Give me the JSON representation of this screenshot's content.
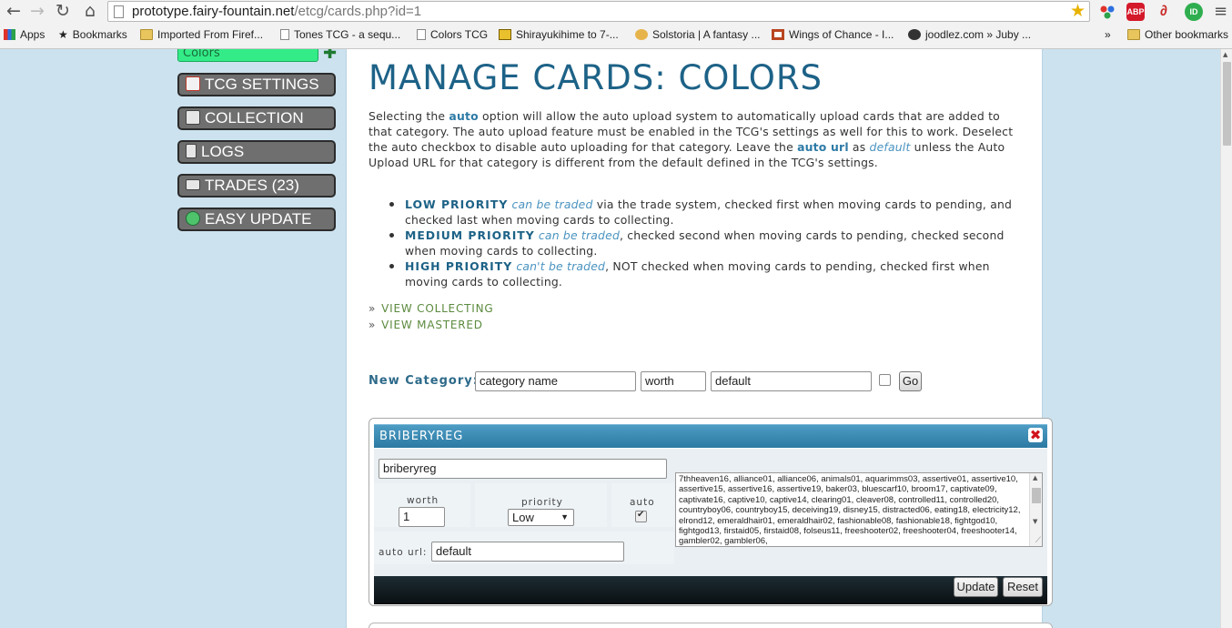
{
  "browser": {
    "url_host": "prototype.fairy-fountain.net",
    "url_path": "/etcg/cards.php?id=1",
    "extensions": [
      "ABP"
    ],
    "bookmarks": [
      {
        "label": "Apps"
      },
      {
        "label": "Bookmarks"
      },
      {
        "label": "Imported From Firef..."
      },
      {
        "label": "Tones TCG - a sequ..."
      },
      {
        "label": "Colors TCG"
      },
      {
        "label": "Shirayukihime to 7-..."
      },
      {
        "label": "Solstoria | A fantasy ..."
      },
      {
        "label": "Wings of Chance - I..."
      },
      {
        "label": "joodlez.com » Juby ..."
      },
      {
        "label": "»"
      },
      {
        "label": "Other bookmarks"
      }
    ]
  },
  "sidebar": {
    "current_tcg": "Colors",
    "buttons": [
      {
        "label": "TCG SETTINGS"
      },
      {
        "label": "COLLECTION"
      },
      {
        "label": "LOGS"
      },
      {
        "label": "TRADES (23)"
      },
      {
        "label": "EASY UPDATE"
      }
    ]
  },
  "main": {
    "title": "MANAGE CARDS: COLORS",
    "intro": {
      "t1": "Selecting the ",
      "k1": "auto",
      "t2": " option will allow the auto upload system to automatically upload cards that are added to that category. The auto upload feature must be enabled in the TCG's settings as well for this to work. Deselect the auto checkbox to disable auto uploading for that category. Leave the ",
      "k2": "auto url",
      "t3": " as ",
      "k3": "default",
      "t4": " unless the Auto Upload URL for that category is different from the default defined in the TCG's settings."
    },
    "priorities": [
      {
        "name": "LOW PRIORITY",
        "note": "can be traded",
        "desc": " via the trade system, checked first when moving cards to pending, and checked last when moving cards to collecting."
      },
      {
        "name": "MEDIUM PRIORITY",
        "note": "can be traded",
        "desc": ", checked second when moving cards to pending, checked second when moving cards to collecting."
      },
      {
        "name": "HIGH PRIORITY",
        "note": "can't be traded",
        "desc": ", NOT checked when moving cards to pending, checked first when moving cards to collecting."
      }
    ],
    "links": [
      {
        "arrow": "»",
        "label": "VIEW COLLECTING"
      },
      {
        "arrow": "»",
        "label": "VIEW MASTERED"
      }
    ],
    "new_category": {
      "label": "New Category:",
      "name_value": "category name",
      "worth_value": "worth",
      "url_value": "default",
      "go_label": "Go"
    },
    "category": {
      "title": "BRIBERYREG",
      "close_symbol": "✖",
      "name_value": "briberyreg",
      "worth_label": "worth",
      "worth_value": "1",
      "priority_label": "priority",
      "priority_value": "Low",
      "auto_label": "auto",
      "auto_url_label": "auto url:",
      "auto_url_value": "default",
      "cards": "7thheaven16, alliance01, alliance06, animals01, aquarimms03, assertive01, assertive10, assertive15, assertive16, assertive19, baker03, bluescarf10, broom17, captivate09, captivate16, captive10, captive14, clearing01, cleaver08, controlled11, controlled20, countryboy06, countryboy15, deceiving19, disney15, distracted06, eating18, electricity12, elrond12, emeraldhair01, emeraldhair02, fashionable08, fashionable18, fightgod10, fightgod13, firstaid05, firstaid08, folseus11, freeshooter02, freeshooter04, freeshooter14, gambler02, gambler06,",
      "update_label": "Update",
      "reset_label": "Reset"
    }
  }
}
